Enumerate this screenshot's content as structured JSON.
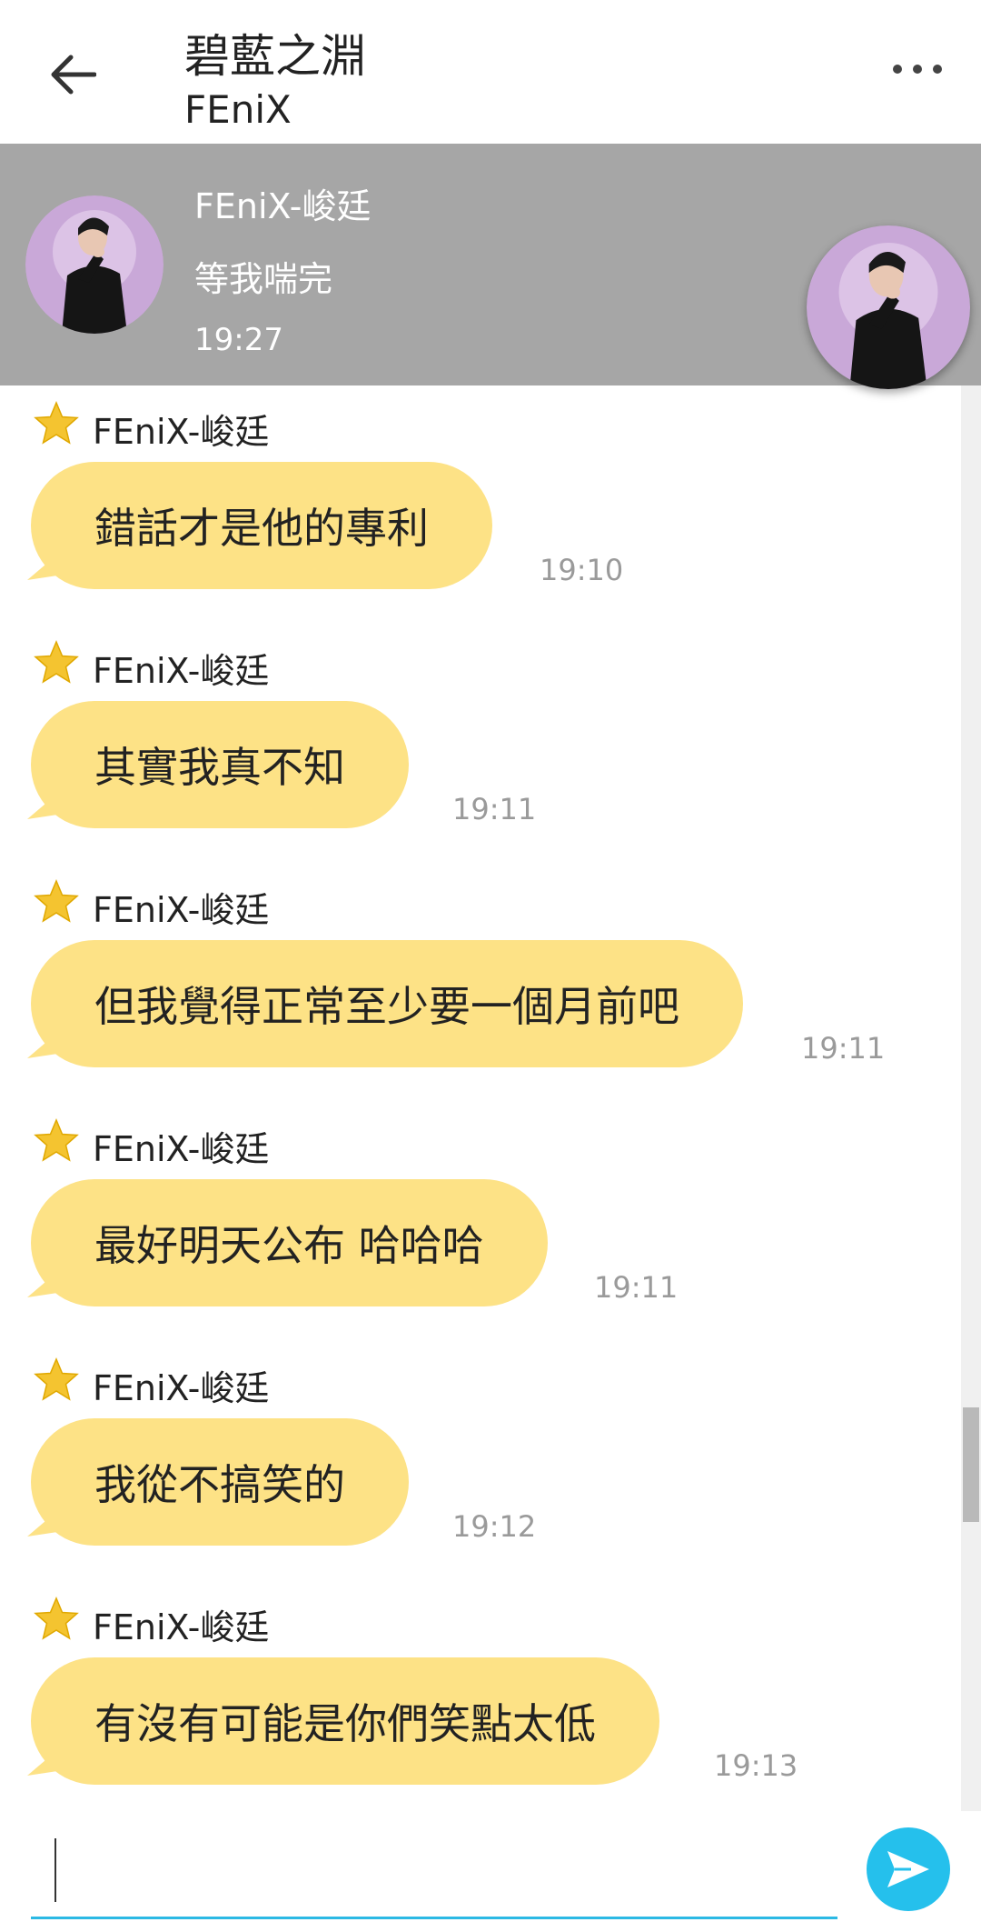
{
  "header": {
    "title": "碧藍之淵",
    "subtitle": "FEniX",
    "back_icon": "arrow-left-icon",
    "more_icon": "more-horizontal-icon"
  },
  "banner": {
    "sender": "FEniX-峻廷",
    "text": "等我喘完",
    "time": "19:27"
  },
  "messages": [
    {
      "sender": "FEniX-峻廷",
      "text": "錯話才是他的專利",
      "time": "19:10"
    },
    {
      "sender": "FEniX-峻廷",
      "text": "其實我真不知",
      "time": "19:11"
    },
    {
      "sender": "FEniX-峻廷",
      "text": "但我覺得正常至少要一個月前吧",
      "time": "19:11"
    },
    {
      "sender": "FEniX-峻廷",
      "text": "最好明天公布 哈哈哈",
      "time": "19:11"
    },
    {
      "sender": "FEniX-峻廷",
      "text": "我從不搞笑的",
      "time": "19:12"
    },
    {
      "sender": "FEniX-峻廷",
      "text": "有沒有可能是你們笑點太低",
      "time": "19:13"
    }
  ],
  "colors": {
    "bubble": "#fde286",
    "banner": "#a6a6a6",
    "accent": "#25c0ec",
    "star": "#f4c430"
  },
  "input": {
    "value": "",
    "send_icon": "send-icon"
  }
}
